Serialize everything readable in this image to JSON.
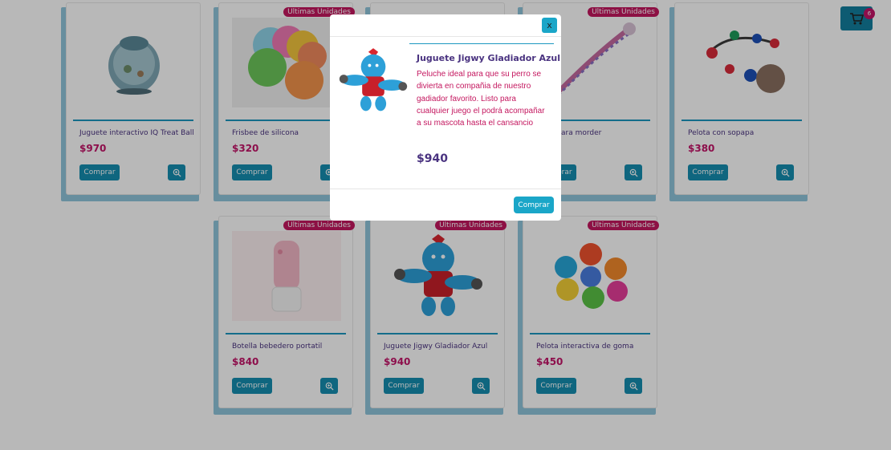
{
  "products": [
    {
      "name": "Juguete interactivo IQ Treat Ball",
      "price": "$970",
      "buy_label": "Comprar",
      "badge": "",
      "icon": "treat-ball"
    },
    {
      "name": "Frisbee de silicona",
      "price": "$320",
      "buy_label": "Comprar",
      "badge": "Ultimas Unidades",
      "icon": "frisbees"
    },
    {
      "name": "",
      "price": "",
      "buy_label": "",
      "badge": "",
      "icon": "hidden"
    },
    {
      "name": "Soga para morder",
      "price": "",
      "buy_label": "Comprar",
      "badge": "Ultimas Unidades",
      "icon": "rope"
    },
    {
      "name": "Pelota con sopapa",
      "price": "$380",
      "buy_label": "Comprar",
      "badge": "",
      "icon": "suction-ball"
    },
    {
      "name": "Botella bebedero portatil",
      "price": "$840",
      "buy_label": "Comprar",
      "badge": "Ultimas Unidades",
      "icon": "water-bottle"
    },
    {
      "name": "Juguete Jigwy Gladiador Azul",
      "price": "$940",
      "buy_label": "Comprar",
      "badge": "Ultimas Unidades",
      "icon": "gladiator"
    },
    {
      "name": "Pelota interactiva de goma",
      "price": "$450",
      "buy_label": "Comprar",
      "badge": "Ultimas Unidades",
      "icon": "rubber-balls"
    }
  ],
  "cart": {
    "count": "6",
    "icon": "cart-icon"
  },
  "modal": {
    "close_label": "x",
    "title": "Juguete Jigwy Gladiador Azul",
    "description": "Peluche ideal para que su perro se divierta en compañia de nuestro gadiador favorito. Listo para cualquier juego el podrá acompañar a su mascota hasta el cansancio",
    "price": "$940",
    "buy_label": "Comprar"
  },
  "colors": {
    "accent": "#168eb0",
    "price": "#c41469",
    "title": "#4a3380",
    "badge": "#c4175f"
  }
}
